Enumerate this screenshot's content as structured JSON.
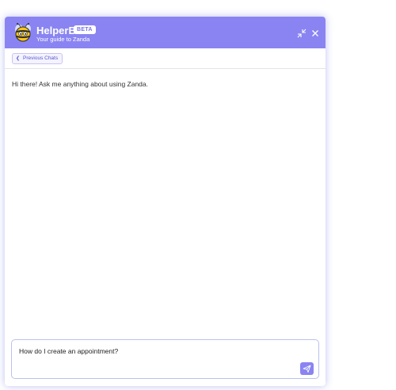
{
  "header": {
    "title": "HelperBee",
    "badge": "BETA",
    "subtitle": "Your guide to Zanda",
    "avatar_icon": "bee-mascot-icon",
    "minimize_icon": "minimize-icon",
    "close_icon": "close-icon",
    "background_color": "#8a84f2"
  },
  "nav": {
    "previous_chats_label": "Previous Chats",
    "previous_chats_icon": "chevron-left-icon"
  },
  "messages": [
    {
      "from": "assistant",
      "text": "Hi there! Ask me anything about using Zanda."
    }
  ],
  "composer": {
    "value": "How do I create an appointment?",
    "send_icon": "send-icon"
  },
  "colors": {
    "accent": "#8a84f2",
    "link": "#5b55cf"
  }
}
